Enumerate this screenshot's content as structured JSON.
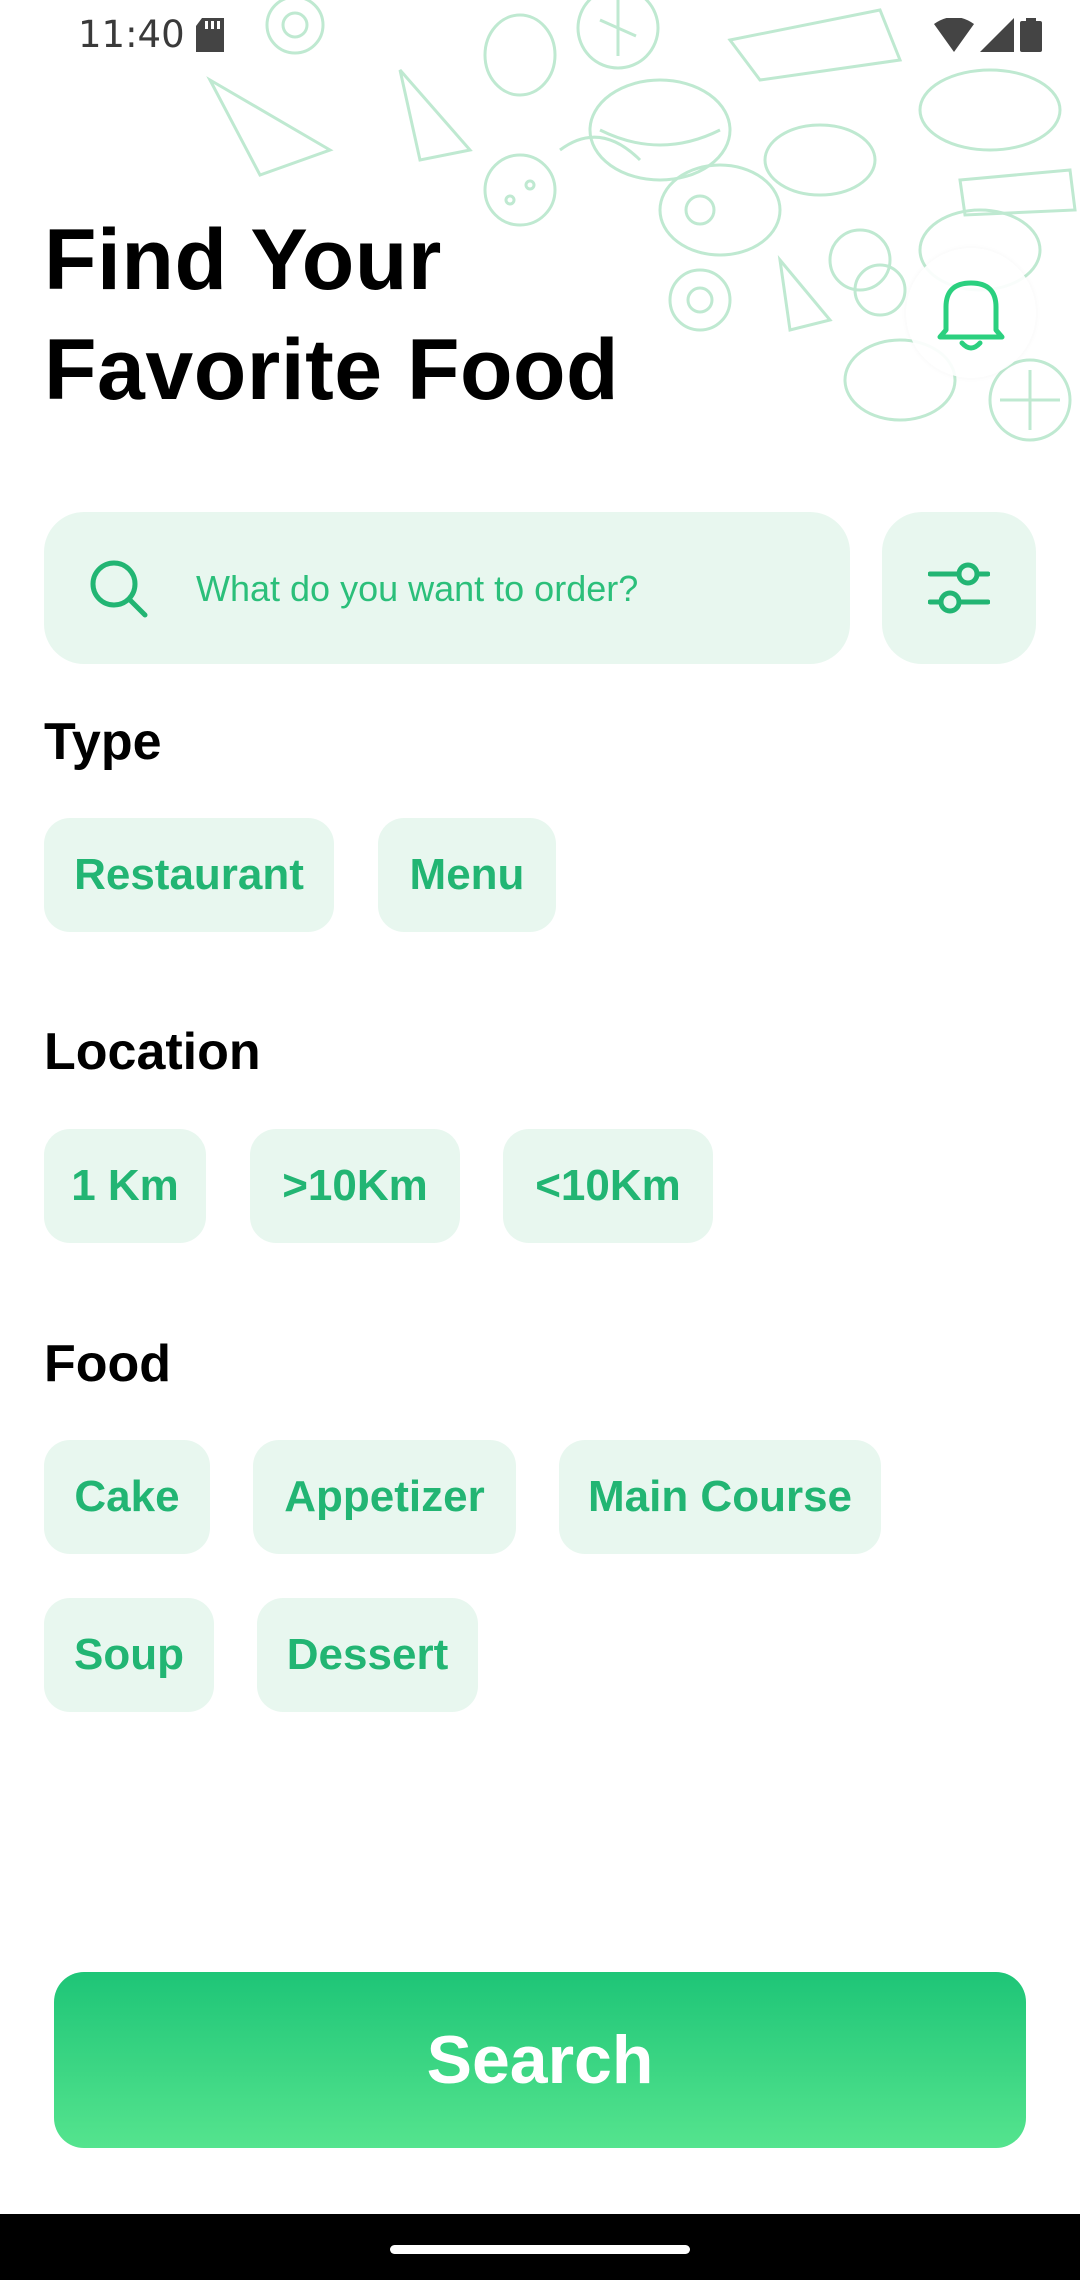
{
  "status_bar": {
    "time": "11:40"
  },
  "header": {
    "title_line1": "Find Your",
    "title_line2": "Favorite Food"
  },
  "search": {
    "placeholder": "What do you want to order?"
  },
  "sections": {
    "type": {
      "title": "Type",
      "chips": [
        "Restaurant",
        "Menu"
      ]
    },
    "location": {
      "title": "Location",
      "chips": [
        "1 Km",
        ">10Km",
        "<10Km"
      ]
    },
    "food": {
      "title": "Food",
      "chips": [
        "Cake",
        "Appetizer",
        "Main Course",
        "Soup",
        "Dessert"
      ]
    }
  },
  "actions": {
    "search_label": "Search"
  },
  "colors": {
    "accent": "#22b573",
    "chip_bg": "#e8f7ef",
    "button_top": "#1ec577",
    "button_bottom": "#55e48e"
  }
}
